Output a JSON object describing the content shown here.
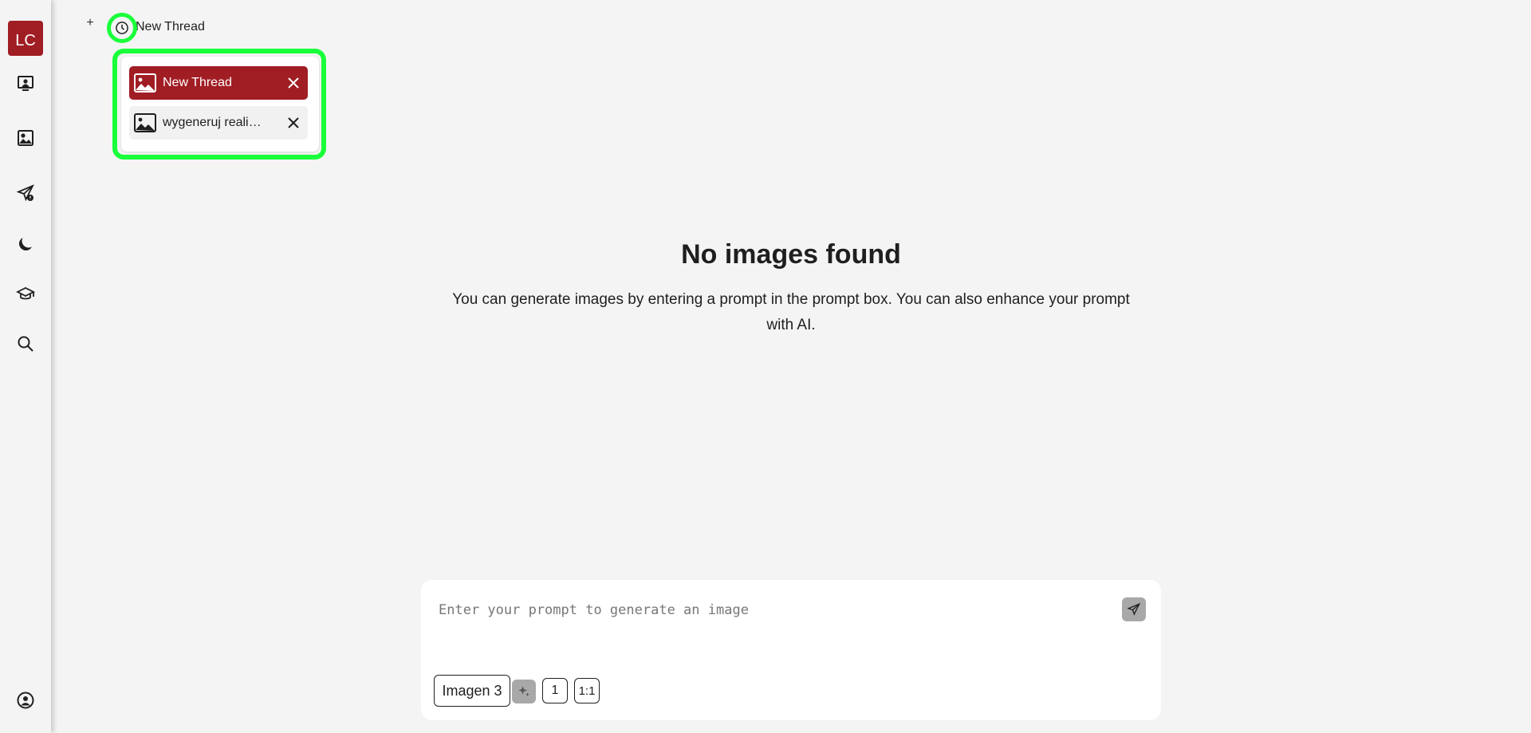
{
  "app": {
    "user_initials": "LC",
    "current_thread_title": "New Thread"
  },
  "topbar": {
    "new_thread_symbol": "+"
  },
  "rail": {
    "items": [
      {
        "icon": "portrait-icon"
      },
      {
        "icon": "image-icon"
      },
      {
        "icon": "send-alert-icon"
      },
      {
        "icon": "moon-icon"
      },
      {
        "icon": "graduation-cap-icon"
      },
      {
        "icon": "search-icon"
      }
    ],
    "bottom_icon": "account-circle-icon"
  },
  "threads": {
    "items": [
      {
        "label": "New Thread",
        "active": true
      },
      {
        "label": "wygeneruj reali…",
        "active": false
      }
    ]
  },
  "empty_state": {
    "title": "No images found",
    "text": "You can generate images by entering a prompt in the prompt box. You can also enhance your prompt with AI."
  },
  "prompt": {
    "placeholder": "Enter your prompt to generate an image",
    "model": "Imagen 3",
    "count": "1",
    "ratio": "1:1"
  },
  "colors": {
    "accent": "#a11d24",
    "highlight": "#19ff3a",
    "background": "#f4f4f4"
  }
}
